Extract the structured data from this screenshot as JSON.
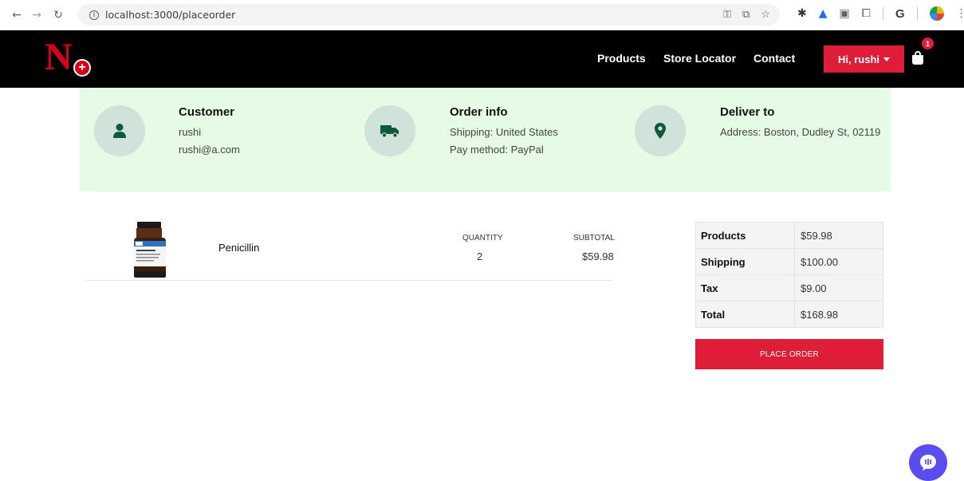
{
  "browser": {
    "url": "localhost:3000/placeorder",
    "profile_letter": "G"
  },
  "header": {
    "nav": {
      "products": "Products",
      "store_locator": "Store Locator",
      "contact": "Contact"
    },
    "user_button": "Hi, rushi",
    "cart_count": "1"
  },
  "info": {
    "customer": {
      "title": "Customer",
      "name": "rushi",
      "email": "rushi@a.com"
    },
    "order": {
      "title": "Order info",
      "shipping": "Shipping: United States",
      "pay_method": "Pay method: PayPal"
    },
    "deliver": {
      "title": "Deliver to",
      "address": "Address: Boston, Dudley St, 02119"
    }
  },
  "items": [
    {
      "name": "Penicillin",
      "quantity_label": "QUANTITY",
      "quantity": "2",
      "subtotal_label": "SUBTOTAL",
      "subtotal": "$59.98"
    }
  ],
  "summary": {
    "rows": [
      {
        "label": "Products",
        "value": "$59.98"
      },
      {
        "label": "Shipping",
        "value": "$100.00"
      },
      {
        "label": "Tax",
        "value": "$9.00"
      },
      {
        "label": "Total",
        "value": "$168.98"
      }
    ],
    "place_order": "PLACE ORDER"
  },
  "colors": {
    "accent_red": "#e01d38",
    "panel_green": "#e5fbe5",
    "icon_green": "#0c5a3a",
    "chat_purple": "#5b4cf0"
  }
}
